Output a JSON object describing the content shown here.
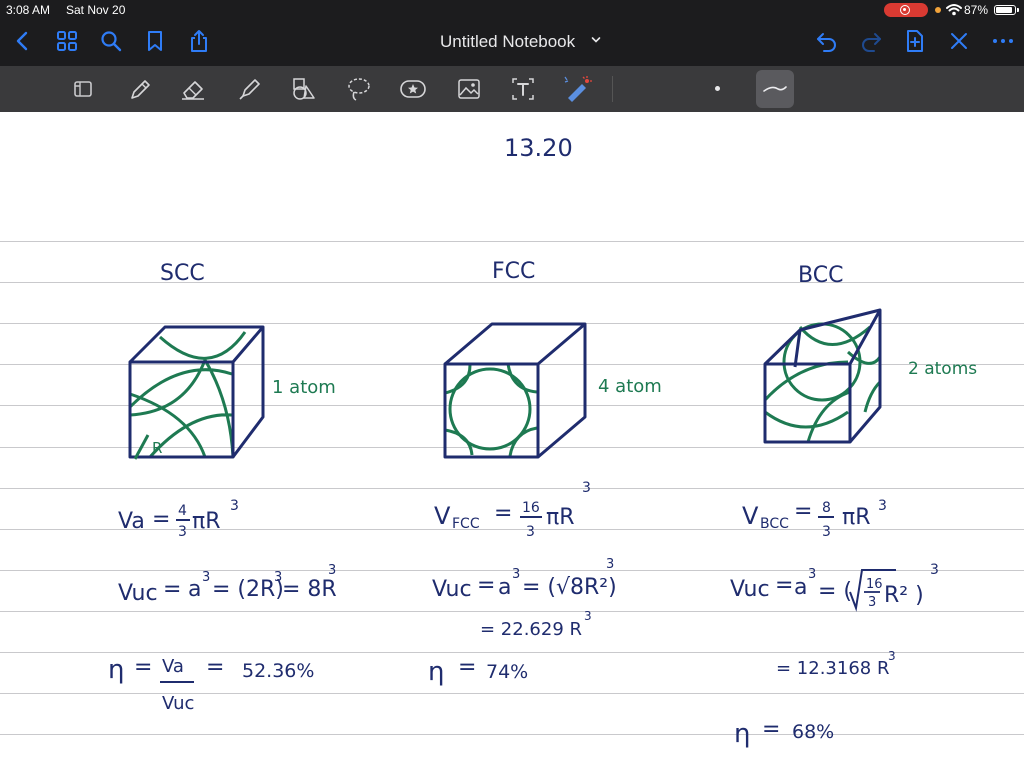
{
  "status_bar": {
    "time": "3:08 AM",
    "date": "Sat Nov 20",
    "battery_percent": "87%",
    "battery_level": 0.87
  },
  "nav_bar": {
    "notebook_title": "Untitled Notebook",
    "icons": [
      "back-icon",
      "thumbnails-icon",
      "search-icon",
      "bookmark-icon",
      "share-icon",
      "undo-icon",
      "redo-icon",
      "add-page-icon",
      "close-icon",
      "more-icon"
    ]
  },
  "toolbar": {
    "tools": [
      "read-mode-icon",
      "pen-icon",
      "eraser-icon",
      "highlighter-icon",
      "shapes-icon",
      "lasso-icon",
      "elements-icon",
      "image-icon",
      "text-icon",
      "laser-pointer-icon"
    ]
  },
  "colors": {
    "ink_blue": "#1f2c6e",
    "ink_green": "#1e7a52",
    "bar_dark": "#1c1c1e",
    "toolbar": "#3a3a3c",
    "accent": "#2f7cf6"
  },
  "notes": {
    "problem_number": "13.20",
    "scc": {
      "heading": "SCC",
      "atoms": "1 atom",
      "radius_label": "R",
      "va_lhs": "Va",
      "va_eq": "=",
      "va_frac_num": "4",
      "va_frac_den": "3",
      "va_rest": "πR",
      "va_exp": "3",
      "vuc_lhs": "Vuc",
      "vuc_eq": "=",
      "vuc_rhs": "a",
      "vuc_rhs_exp": "3",
      "vuc_rhs2": "= (2R)",
      "vuc_rhs2_exp": "3",
      "vuc_rhs3": "= 8R",
      "vuc_rhs3_exp": "3",
      "eta": "η",
      "eta_eq": "=",
      "eta_frac_num": "Va",
      "eta_frac_den": "Vuc",
      "eta_eq2": "=",
      "eta_val": "52.36%"
    },
    "fcc": {
      "heading": "FCC",
      "atoms": "4 atom",
      "v_lhs": "V",
      "v_sub": "FCC",
      "v_eq": "=",
      "v_frac_num": "16",
      "v_frac_den": "3",
      "v_rest": "πR",
      "v_exp": "3",
      "vuc_lhs": "Vuc",
      "vuc_eq": "=",
      "vuc_rhs": "a",
      "vuc_rhs_exp": "3",
      "vuc_rhs2": "= (√8R²)",
      "vuc_rhs2_exp": "3",
      "vuc_line2": "= 22.629 R",
      "vuc_line2_exp": "3",
      "eta": "η",
      "eta_eq": "=",
      "eta_val": "74%"
    },
    "bcc": {
      "heading": "BCC",
      "atoms": "2 atoms",
      "v_lhs": "V",
      "v_sub": "BCC",
      "v_eq": "=",
      "v_frac_num": "8",
      "v_frac_den": "3",
      "v_rest": "πR",
      "v_exp": "3",
      "vuc_lhs": "Vuc",
      "vuc_eq": "=",
      "vuc_rhs": "a",
      "vuc_rhs_exp": "3",
      "vuc_rhs2_open": "= (",
      "vuc_frac_num": "16",
      "vuc_frac_den": "3",
      "vuc_rhs2_close": "R² )",
      "vuc_rhs2_exp": "3",
      "vuc_line2": "= 12.3168 R",
      "vuc_line2_exp": "3",
      "eta": "η",
      "eta_eq": "=",
      "eta_val": "68%"
    }
  }
}
